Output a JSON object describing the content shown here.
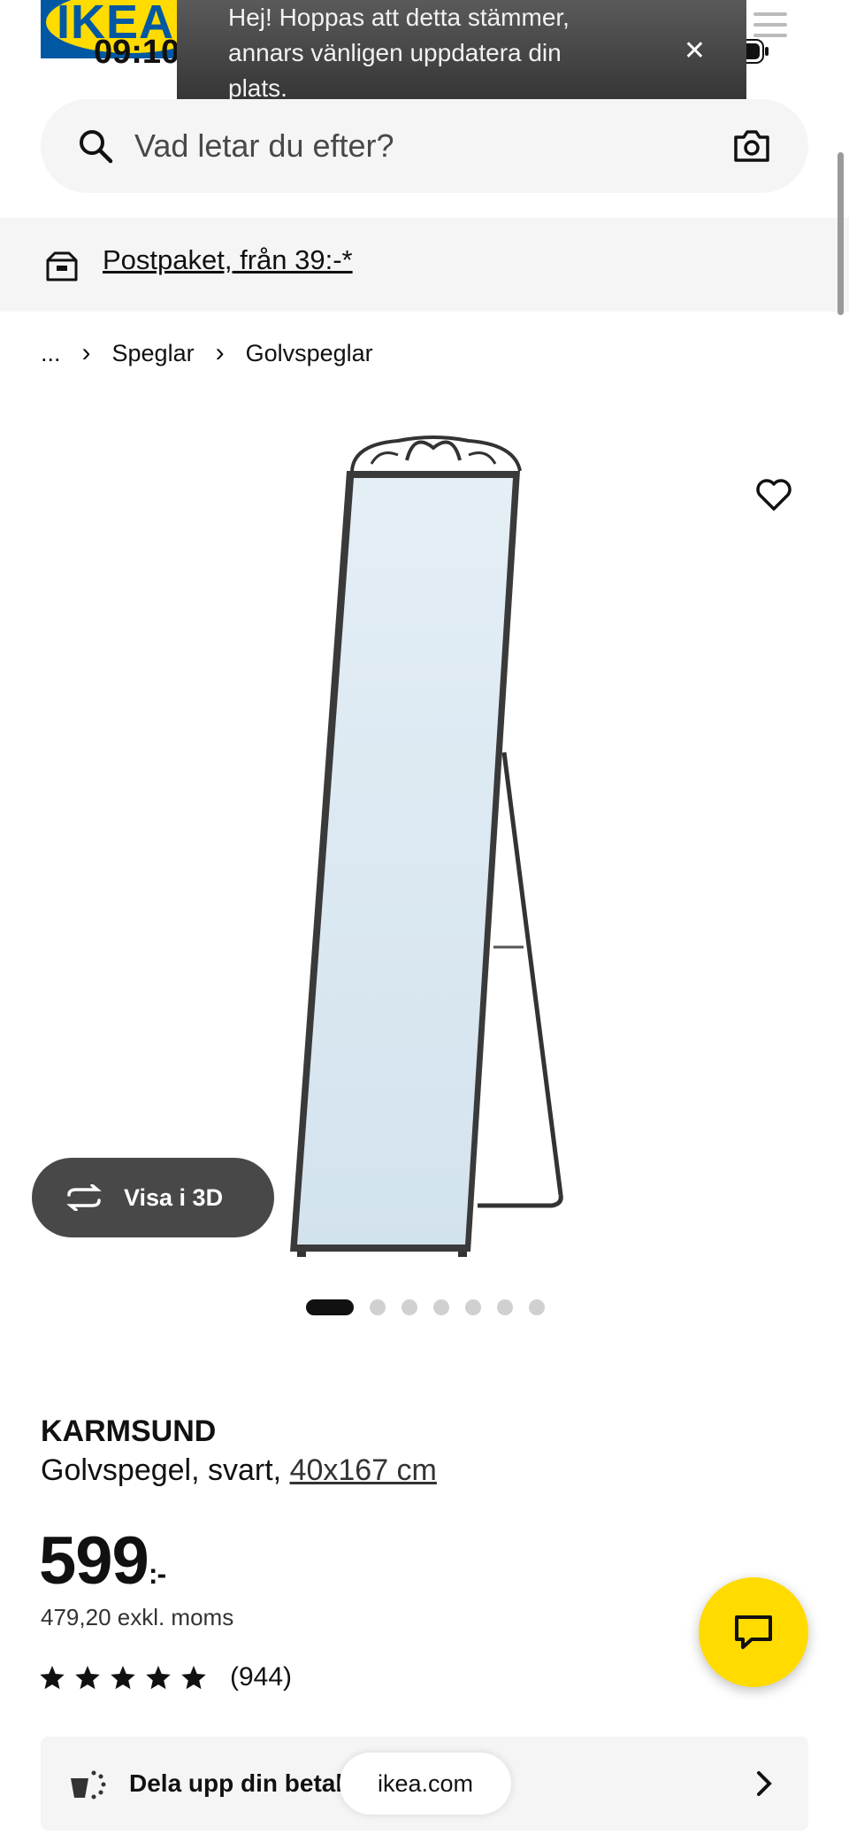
{
  "status_bar": {
    "time": "09:10"
  },
  "header": {
    "logo_text": "IKEA"
  },
  "notification": {
    "message": "Hej! Hoppas att detta stämmer, annars vänligen uppdatera din plats.",
    "close_symbol": "✕"
  },
  "search": {
    "placeholder": "Vad letar du efter?"
  },
  "delivery": {
    "link_text": "Postpaket, från 39:-*"
  },
  "breadcrumb": {
    "ellipsis": "...",
    "items": [
      "Speglar",
      "Golvspeglar"
    ]
  },
  "gallery": {
    "view_3d_label": "Visa i 3D",
    "image_count": 7,
    "active_index": 0
  },
  "product": {
    "name": "KARMSUND",
    "description": "Golvspegel, svart, ",
    "size": "40x167 cm",
    "price": "599",
    "price_suffix": ":-",
    "price_ex_vat": "479,20 exkl. moms",
    "rating_stars": 5,
    "rating_count": "(944)"
  },
  "payment": {
    "label": "Dela upp din betalning"
  },
  "browser": {
    "url": "ikea.com"
  },
  "colors": {
    "brand_yellow": "#ffdb00",
    "brand_blue": "#0058a3",
    "dark_button": "#484848"
  }
}
